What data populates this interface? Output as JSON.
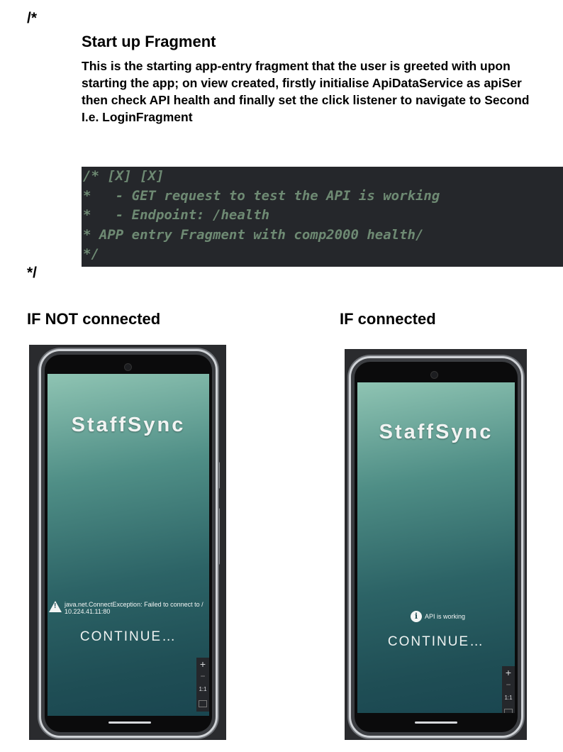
{
  "document": {
    "open_marker": "/*",
    "close_marker": "*/",
    "section_title": "Start up Fragment",
    "description_lines": [
      "This is the starting app-entry fragment that the user is greeted with upon",
      "starting the app; on view created, firstly initialise ApiDataService as apiSer",
      "then check API health and finally set the click listener to navigate to Second",
      "I.e. LoginFragment"
    ],
    "code_lines": [
      "/* [X] [X]",
      "*   - GET request to test the API is working",
      "*   - Endpoint: /health",
      "* APP entry Fragment with comp2000 health/",
      "*/"
    ],
    "caption_not_connected": "IF NOT connected",
    "caption_connected": "IF connected"
  },
  "screens": {
    "not_connected": {
      "app_title": "StaffSync",
      "status_icon": "warning-icon",
      "status_lines": [
        "java.net.ConnectException: Failed to connect to /",
        "10.224.41.11:80"
      ],
      "continue_label": "CONTINUE…"
    },
    "connected": {
      "app_title": "StaffSync",
      "status_icon": "info-icon",
      "status_text": "API is working",
      "continue_label": "CONTINUE…"
    },
    "zoom_controls": {
      "plus": "+",
      "minus": "−",
      "one_to_one": "1:1"
    }
  },
  "colors": {
    "code_background": "#25272b",
    "code_comment": "#6e8a73",
    "screen_gradient_top": "#8fc4b3",
    "screen_gradient_bottom": "#1a4650"
  }
}
